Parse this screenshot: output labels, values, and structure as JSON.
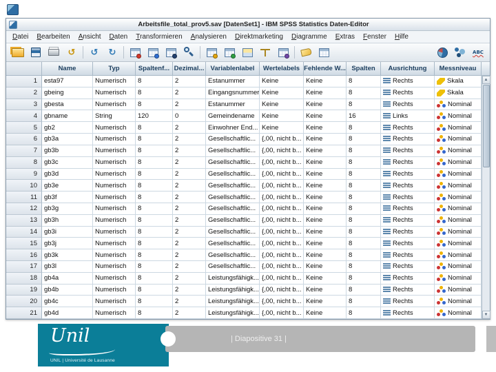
{
  "window": {
    "title": "Arbeitsfile_total_prov5.sav [DatenSet1] - IBM SPSS Statistics Daten-Editor",
    "menus": [
      "Datei",
      "Bearbeiten",
      "Ansicht",
      "Daten",
      "Transformieren",
      "Analysieren",
      "Direktmarketing",
      "Diagramme",
      "Extras",
      "Fenster",
      "Hilfe"
    ],
    "toolbar": [
      {
        "name": "open-file-icon",
        "kind": "k-folder"
      },
      {
        "name": "save-icon",
        "kind": "k-disk"
      },
      {
        "name": "print-icon",
        "kind": "k-printer"
      },
      {
        "name": "recall-dialogs-icon",
        "kind": "glyph-gold",
        "glyph": "↺"
      },
      {
        "kind": "sep"
      },
      {
        "name": "undo-icon",
        "kind": "glyph-blue",
        "glyph": "↺"
      },
      {
        "name": "redo-icon",
        "kind": "glyph-blue",
        "glyph": "↻"
      },
      {
        "kind": "sep"
      },
      {
        "name": "goto-case-icon",
        "kind": "k-grid dot-red"
      },
      {
        "name": "goto-variable-icon",
        "kind": "k-grid dot-blue"
      },
      {
        "name": "variables-icon",
        "kind": "k-grid dot-navy"
      },
      {
        "name": "find-icon",
        "kind": "k-find"
      },
      {
        "kind": "sep"
      },
      {
        "name": "insert-cases-icon",
        "kind": "k-grid dot-gold"
      },
      {
        "name": "insert-variable-icon",
        "kind": "k-grid dot-green"
      },
      {
        "name": "split-file-icon",
        "kind": "k-split"
      },
      {
        "name": "weight-cases-icon",
        "kind": "k-scale"
      },
      {
        "name": "select-cases-icon",
        "kind": "k-grid dot-purple"
      },
      {
        "kind": "sep"
      },
      {
        "name": "value-labels-icon",
        "kind": "k-tag"
      },
      {
        "name": "use-variable-sets-icon",
        "kind": "k-grid"
      },
      {
        "name": "chart-icon",
        "kind": "k-pie push"
      },
      {
        "name": "bubble-chart-icon",
        "kind": "k-bubbles"
      },
      {
        "name": "spelling-icon",
        "kind": "k-abc",
        "glyph": "ABC"
      }
    ],
    "scrollbar": {
      "up": "▲",
      "down": "▼"
    }
  },
  "table": {
    "headers": [
      "",
      "Name",
      "Typ",
      "Spaltenf...",
      "Dezimal...",
      "Variablenlabel",
      "Wertelabels",
      "Fehlende W...",
      "Spalten",
      "Ausrichtung",
      "Messniveau"
    ],
    "rows": [
      {
        "num": "1",
        "name": "esta97",
        "typ": "Numerisch",
        "breite": "8",
        "dezimale": "2",
        "label": "Estanummer",
        "wertelabels": "Keine",
        "fehlende": "Keine",
        "spalten": "8",
        "ausrichtung": "Rechts",
        "messniveau": "Skala",
        "mess_kind": "scale"
      },
      {
        "num": "2",
        "name": "gbeing",
        "typ": "Numerisch",
        "breite": "8",
        "dezimale": "2",
        "label": "Eingangsnummer",
        "wertelabels": "Keine",
        "fehlende": "Keine",
        "spalten": "8",
        "ausrichtung": "Rechts",
        "messniveau": "Skala",
        "mess_kind": "scale"
      },
      {
        "num": "3",
        "name": "gbesta",
        "typ": "Numerisch",
        "breite": "8",
        "dezimale": "2",
        "label": "Estanummer",
        "wertelabels": "Keine",
        "fehlende": "Keine",
        "spalten": "8",
        "ausrichtung": "Rechts",
        "messniveau": "Nominal",
        "mess_kind": "nominal"
      },
      {
        "num": "4",
        "name": "gbname",
        "typ": "String",
        "breite": "120",
        "dezimale": "0",
        "label": "Gemeindename",
        "wertelabels": "Keine",
        "fehlende": "Keine",
        "spalten": "16",
        "ausrichtung": "Links",
        "messniveau": "Nominal",
        "mess_kind": "nominal"
      },
      {
        "num": "5",
        "name": "gb2",
        "typ": "Numerisch",
        "breite": "8",
        "dezimale": "2",
        "label": "Einwohner End...",
        "wertelabels": "Keine",
        "fehlende": "Keine",
        "spalten": "8",
        "ausrichtung": "Rechts",
        "messniveau": "Nominal",
        "mess_kind": "nominal"
      },
      {
        "num": "6",
        "name": "gb3a",
        "typ": "Numerisch",
        "breite": "8",
        "dezimale": "2",
        "label": "Gesellschaftlic...",
        "wertelabels": "{,00, nicht b...",
        "fehlende": "Keine",
        "spalten": "8",
        "ausrichtung": "Rechts",
        "messniveau": "Nominal",
        "mess_kind": "nominal"
      },
      {
        "num": "7",
        "name": "gb3b",
        "typ": "Numerisch",
        "breite": "8",
        "dezimale": "2",
        "label": "Gesellschaftlic...",
        "wertelabels": "{,00, nicht b...",
        "fehlende": "Keine",
        "spalten": "8",
        "ausrichtung": "Rechts",
        "messniveau": "Nominal",
        "mess_kind": "nominal"
      },
      {
        "num": "8",
        "name": "gb3c",
        "typ": "Numerisch",
        "breite": "8",
        "dezimale": "2",
        "label": "Gesellschaftlic...",
        "wertelabels": "{,00, nicht b...",
        "fehlende": "Keine",
        "spalten": "8",
        "ausrichtung": "Rechts",
        "messniveau": "Nominal",
        "mess_kind": "nominal"
      },
      {
        "num": "9",
        "name": "gb3d",
        "typ": "Numerisch",
        "breite": "8",
        "dezimale": "2",
        "label": "Gesellschaftlic...",
        "wertelabels": "{,00, nicht b...",
        "fehlende": "Keine",
        "spalten": "8",
        "ausrichtung": "Rechts",
        "messniveau": "Nominal",
        "mess_kind": "nominal"
      },
      {
        "num": "10",
        "name": "gb3e",
        "typ": "Numerisch",
        "breite": "8",
        "dezimale": "2",
        "label": "Gesellschaftlic...",
        "wertelabels": "{,00, nicht b...",
        "fehlende": "Keine",
        "spalten": "8",
        "ausrichtung": "Rechts",
        "messniveau": "Nominal",
        "mess_kind": "nominal"
      },
      {
        "num": "11",
        "name": "gb3f",
        "typ": "Numerisch",
        "breite": "8",
        "dezimale": "2",
        "label": "Gesellschaftlic...",
        "wertelabels": "{,00, nicht b...",
        "fehlende": "Keine",
        "spalten": "8",
        "ausrichtung": "Rechts",
        "messniveau": "Nominal",
        "mess_kind": "nominal"
      },
      {
        "num": "12",
        "name": "gb3g",
        "typ": "Numerisch",
        "breite": "8",
        "dezimale": "2",
        "label": "Gesellschaftlic...",
        "wertelabels": "{,00, nicht b...",
        "fehlende": "Keine",
        "spalten": "8",
        "ausrichtung": "Rechts",
        "messniveau": "Nominal",
        "mess_kind": "nominal"
      },
      {
        "num": "13",
        "name": "gb3h",
        "typ": "Numerisch",
        "breite": "8",
        "dezimale": "2",
        "label": "Gesellschaftlic...",
        "wertelabels": "{,00, nicht b...",
        "fehlende": "Keine",
        "spalten": "8",
        "ausrichtung": "Rechts",
        "messniveau": "Nominal",
        "mess_kind": "nominal"
      },
      {
        "num": "14",
        "name": "gb3i",
        "typ": "Numerisch",
        "breite": "8",
        "dezimale": "2",
        "label": "Gesellschaftlic...",
        "wertelabels": "{,00, nicht b...",
        "fehlende": "Keine",
        "spalten": "8",
        "ausrichtung": "Rechts",
        "messniveau": "Nominal",
        "mess_kind": "nominal"
      },
      {
        "num": "15",
        "name": "gb3j",
        "typ": "Numerisch",
        "breite": "8",
        "dezimale": "2",
        "label": "Gesellschaftlic...",
        "wertelabels": "{,00, nicht b...",
        "fehlende": "Keine",
        "spalten": "8",
        "ausrichtung": "Rechts",
        "messniveau": "Nominal",
        "mess_kind": "nominal"
      },
      {
        "num": "16",
        "name": "gb3k",
        "typ": "Numerisch",
        "breite": "8",
        "dezimale": "2",
        "label": "Gesellschaftlic...",
        "wertelabels": "{,00, nicht b...",
        "fehlende": "Keine",
        "spalten": "8",
        "ausrichtung": "Rechts",
        "messniveau": "Nominal",
        "mess_kind": "nominal"
      },
      {
        "num": "17",
        "name": "gb3l",
        "typ": "Numerisch",
        "breite": "8",
        "dezimale": "2",
        "label": "Gesellschaftlic...",
        "wertelabels": "{,00, nicht b...",
        "fehlende": "Keine",
        "spalten": "8",
        "ausrichtung": "Rechts",
        "messniveau": "Nominal",
        "mess_kind": "nominal"
      },
      {
        "num": "18",
        "name": "gb4a",
        "typ": "Numerisch",
        "breite": "8",
        "dezimale": "2",
        "label": "Leistungsfähigk...",
        "wertelabels": "{,00, nicht b...",
        "fehlende": "Keine",
        "spalten": "8",
        "ausrichtung": "Rechts",
        "messniveau": "Nominal",
        "mess_kind": "nominal"
      },
      {
        "num": "19",
        "name": "gb4b",
        "typ": "Numerisch",
        "breite": "8",
        "dezimale": "2",
        "label": "Leistungsfähigk...",
        "wertelabels": "{,00, nicht b...",
        "fehlende": "Keine",
        "spalten": "8",
        "ausrichtung": "Rechts",
        "messniveau": "Nominal",
        "mess_kind": "nominal"
      },
      {
        "num": "20",
        "name": "gb4c",
        "typ": "Numerisch",
        "breite": "8",
        "dezimale": "2",
        "label": "Leistungsfähigk...",
        "wertelabels": "{,00, nicht b...",
        "fehlende": "Keine",
        "spalten": "8",
        "ausrichtung": "Rechts",
        "messniveau": "Nominal",
        "mess_kind": "nominal"
      },
      {
        "num": "21",
        "name": "gb4d",
        "typ": "Numerisch",
        "breite": "8",
        "dezimale": "2",
        "label": "Leistungsfähigk...",
        "wertelabels": "{,00, nicht b...",
        "fehlende": "Keine",
        "spalten": "8",
        "ausrichtung": "Rechts",
        "messniveau": "Nominal",
        "mess_kind": "nominal"
      }
    ]
  },
  "footer": {
    "slide_label": "| Diapositive 31 |",
    "logo_script": "Unil",
    "logo_subtext": "UNIL | Université de Lausanne"
  },
  "colors": {
    "teal": "#0b7e98",
    "gray_bar": "#b5b5b5"
  }
}
